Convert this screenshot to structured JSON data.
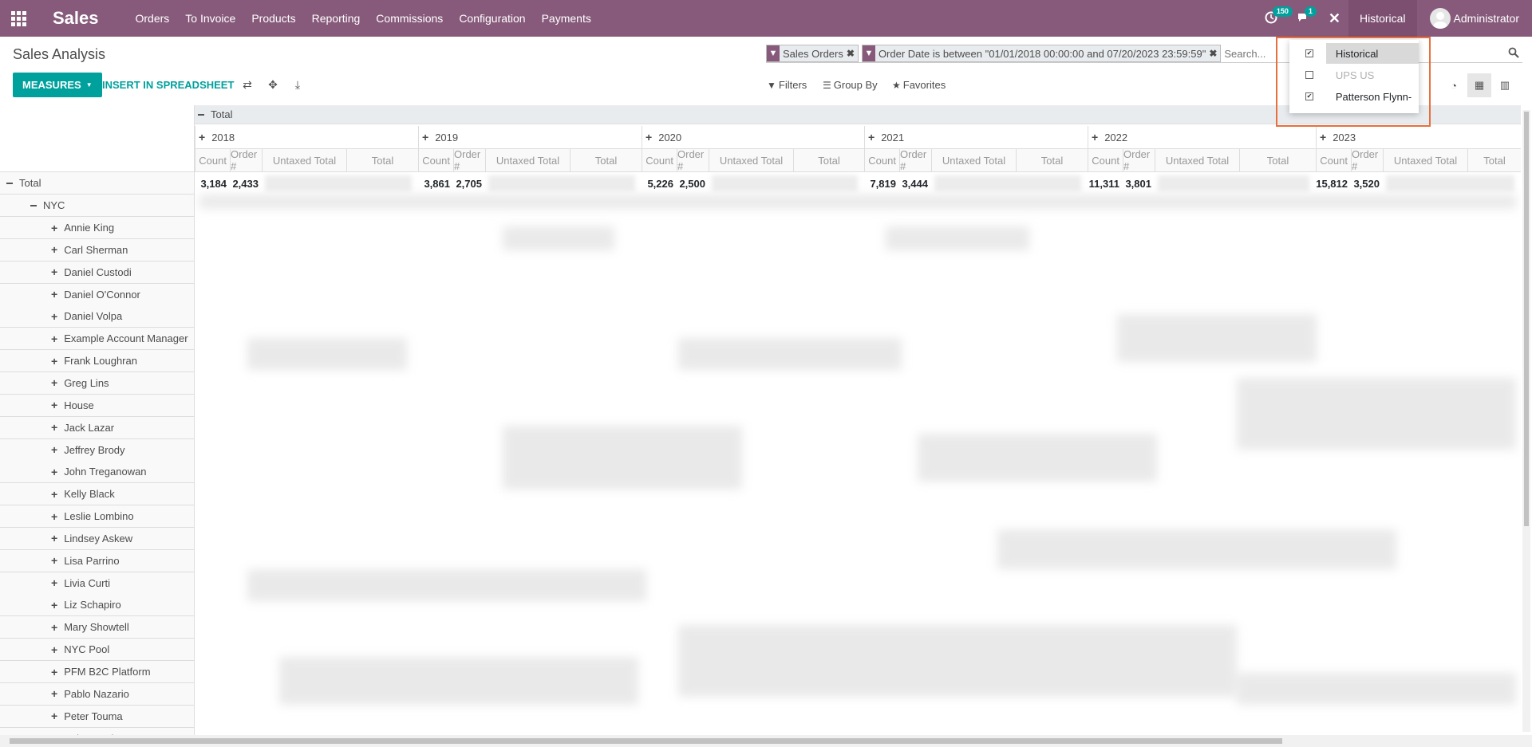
{
  "navbar": {
    "brand": "Sales",
    "menu": [
      "Orders",
      "To Invoice",
      "Products",
      "Reporting",
      "Commissions",
      "Configuration",
      "Payments"
    ],
    "activity_badge": "150",
    "messages_badge": "1",
    "company_switch": "Historical",
    "user": "Administrator"
  },
  "control_panel": {
    "title": "Sales Analysis",
    "facets": [
      {
        "label": "Sales Orders"
      },
      {
        "label": "Order Date is between \"01/01/2018 00:00:00 and 07/20/2023 23:59:59\""
      }
    ],
    "search_placeholder": "Search...",
    "measures_label": "MEASURES",
    "spreadsheet_label": "INSERT IN SPREADSHEET",
    "filters_label": "Filters",
    "groupby_label": "Group By",
    "favorites_label": "Favorites"
  },
  "company_dropdown": {
    "items": [
      {
        "label": "Historical",
        "checked": true,
        "active": true
      },
      {
        "label": "UPS US",
        "checked": false,
        "active": false
      },
      {
        "label": "Patterson Flynn-",
        "checked": true,
        "active": false
      }
    ]
  },
  "pivot": {
    "total_header": "Total",
    "years": [
      "2018",
      "2019",
      "2020",
      "2021",
      "2022",
      "2023"
    ],
    "measures": [
      "Count",
      "Order #",
      "Untaxed Total",
      "Total"
    ],
    "total_row_label": "Total",
    "total_row_values": [
      {
        "count": "3,184",
        "orders": "2,433"
      },
      {
        "count": "3,861",
        "orders": "2,705"
      },
      {
        "count": "5,226",
        "orders": "2,500"
      },
      {
        "count": "7,819",
        "orders": "3,444"
      },
      {
        "count": "11,311",
        "orders": "3,801"
      },
      {
        "count": "15,812",
        "orders": "3,520"
      }
    ],
    "group_label": "NYC",
    "rows": [
      "Annie King",
      "Carl Sherman",
      "Daniel Custodi",
      "Daniel O'Connor",
      "Daniel Volpa",
      "Example Account Manager",
      "Frank Loughran",
      "Greg Lins",
      "House",
      "Jack Lazar",
      "Jeffrey Brody",
      "John Treganowan",
      "Kelly Black",
      "Leslie Lombino",
      "Lindsey Askew",
      "Lisa Parrino",
      "Livia Curti",
      "Liz Schapiro",
      "Mary Showtell",
      "NYC Pool",
      "PFM B2C Platform",
      "Pablo Nazario",
      "Peter Touma",
      "Sales Pool"
    ]
  },
  "colors": {
    "brand": "#875a7b",
    "accent": "#00a09d",
    "highlight": "#e86f3c"
  }
}
